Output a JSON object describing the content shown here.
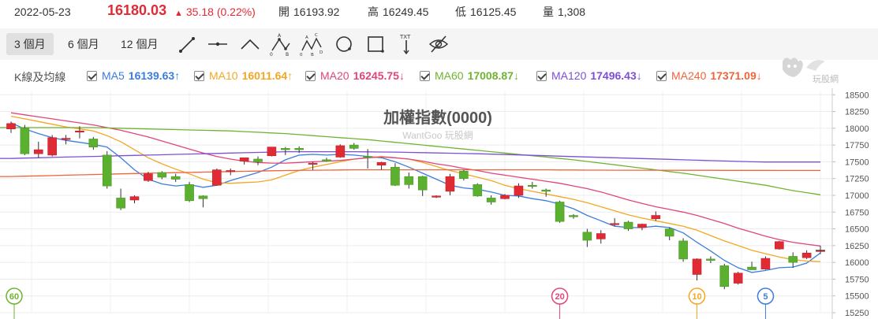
{
  "quote": {
    "date": "2022-05-23",
    "price": "16180.03",
    "change": "35.18 (0.22%)",
    "open_label": "開",
    "open": "16193.92",
    "high_label": "高",
    "high": "16249.45",
    "low_label": "低",
    "low": "16125.45",
    "volume_label": "量",
    "volume": "1,308",
    "up_color": "#e02b35"
  },
  "toolbar": {
    "ranges": [
      "3 個月",
      "6 個月",
      "12 個月"
    ],
    "active_range": "3 個月",
    "tools": [
      "line-tool-icon",
      "horizontal-line-tool-icon",
      "angle-tool-icon",
      "abc-pattern-tool-icon",
      "abcd-pattern-tool-icon",
      "circle-tool-icon",
      "rectangle-tool-icon",
      "text-tool-icon",
      "hide-drawings-icon"
    ],
    "text_tool_label": "TXT"
  },
  "ma_row": {
    "label": "K線及均線",
    "items": [
      {
        "name": "MA5",
        "value": "16139.63",
        "arrow": "↑",
        "color": "#3b7ddd"
      },
      {
        "name": "MA10",
        "value": "16011.64",
        "arrow": "↑",
        "color": "#f5a623"
      },
      {
        "name": "MA20",
        "value": "16245.75",
        "arrow": "↓",
        "color": "#e0457b"
      },
      {
        "name": "MA60",
        "value": "17008.87",
        "arrow": "↓",
        "color": "#6fb431"
      },
      {
        "name": "MA120",
        "value": "17496.43",
        "arrow": "↓",
        "color": "#7d4fd6"
      },
      {
        "name": "MA240",
        "value": "17371.09",
        "arrow": "↓",
        "color": "#f0643c"
      }
    ]
  },
  "logo_text": "玩股網",
  "chart_data": {
    "type": "candlestick",
    "title": "加權指數(0000)",
    "watermark": "WantGoo 玩股網",
    "ylim": [
      15250,
      18550
    ],
    "y_ticks": [
      18500,
      18250,
      18000,
      17750,
      17500,
      17250,
      17000,
      16750,
      16500,
      16250,
      16000,
      15750,
      15500,
      15250
    ],
    "grid": true,
    "up_color": "#e02b35",
    "down_color": "#5cb030",
    "candles": [
      {
        "o": 17990,
        "h": 18100,
        "l": 17930,
        "c": 18070
      },
      {
        "o": 18000,
        "h": 18050,
        "l": 17600,
        "c": 17620
      },
      {
        "o": 17620,
        "h": 17800,
        "l": 17560,
        "c": 17680
      },
      {
        "o": 17600,
        "h": 17900,
        "l": 17580,
        "c": 17860
      },
      {
        "o": 17850,
        "h": 17900,
        "l": 17760,
        "c": 17850
      },
      {
        "o": 17960,
        "h": 18030,
        "l": 17850,
        "c": 17960
      },
      {
        "o": 17840,
        "h": 17870,
        "l": 17680,
        "c": 17720
      },
      {
        "o": 17600,
        "h": 17660,
        "l": 17100,
        "c": 17140
      },
      {
        "o": 16960,
        "h": 17100,
        "l": 16780,
        "c": 16810
      },
      {
        "o": 16930,
        "h": 17000,
        "l": 16880,
        "c": 16980
      },
      {
        "o": 17220,
        "h": 17350,
        "l": 17200,
        "c": 17320
      },
      {
        "o": 17340,
        "h": 17360,
        "l": 17240,
        "c": 17270
      },
      {
        "o": 17280,
        "h": 17320,
        "l": 17200,
        "c": 17240
      },
      {
        "o": 17160,
        "h": 17200,
        "l": 16900,
        "c": 16920
      },
      {
        "o": 16990,
        "h": 17000,
        "l": 16820,
        "c": 16950
      },
      {
        "o": 17150,
        "h": 17400,
        "l": 17140,
        "c": 17380
      },
      {
        "o": 17360,
        "h": 17400,
        "l": 17300,
        "c": 17370
      },
      {
        "o": 17510,
        "h": 17560,
        "l": 17460,
        "c": 17560
      },
      {
        "o": 17540,
        "h": 17580,
        "l": 17450,
        "c": 17500
      },
      {
        "o": 17590,
        "h": 17720,
        "l": 17580,
        "c": 17720
      },
      {
        "o": 17700,
        "h": 17720,
        "l": 17600,
        "c": 17680
      },
      {
        "o": 17700,
        "h": 17730,
        "l": 17630,
        "c": 17680
      },
      {
        "o": 17470,
        "h": 17500,
        "l": 17380,
        "c": 17480
      },
      {
        "o": 17530,
        "h": 17560,
        "l": 17500,
        "c": 17510
      },
      {
        "o": 17570,
        "h": 17760,
        "l": 17560,
        "c": 17740
      },
      {
        "o": 17750,
        "h": 17780,
        "l": 17680,
        "c": 17700
      },
      {
        "o": 17580,
        "h": 17690,
        "l": 17400,
        "c": 17570
      },
      {
        "o": 17450,
        "h": 17500,
        "l": 17380,
        "c": 17490
      },
      {
        "o": 17420,
        "h": 17480,
        "l": 17140,
        "c": 17150
      },
      {
        "o": 17280,
        "h": 17340,
        "l": 17100,
        "c": 17160
      },
      {
        "o": 17280,
        "h": 17290,
        "l": 16990,
        "c": 17080
      },
      {
        "o": 16990,
        "h": 17000,
        "l": 16960,
        "c": 16990
      },
      {
        "o": 17060,
        "h": 17320,
        "l": 17000,
        "c": 17280
      },
      {
        "o": 17360,
        "h": 17380,
        "l": 17220,
        "c": 17250
      },
      {
        "o": 17160,
        "h": 17180,
        "l": 16980,
        "c": 16990
      },
      {
        "o": 16960,
        "h": 17000,
        "l": 16860,
        "c": 16900
      },
      {
        "o": 16950,
        "h": 17020,
        "l": 16940,
        "c": 17000
      },
      {
        "o": 17000,
        "h": 17180,
        "l": 16960,
        "c": 17140
      },
      {
        "o": 17150,
        "h": 17200,
        "l": 17100,
        "c": 17140
      },
      {
        "o": 17080,
        "h": 17100,
        "l": 16980,
        "c": 17060
      },
      {
        "o": 16900,
        "h": 16920,
        "l": 16590,
        "c": 16610
      },
      {
        "o": 16700,
        "h": 16720,
        "l": 16650,
        "c": 16680
      },
      {
        "o": 16450,
        "h": 16500,
        "l": 16230,
        "c": 16330
      },
      {
        "o": 16350,
        "h": 16480,
        "l": 16280,
        "c": 16430
      },
      {
        "o": 16580,
        "h": 16660,
        "l": 16540,
        "c": 16580
      },
      {
        "o": 16600,
        "h": 16620,
        "l": 16470,
        "c": 16500
      },
      {
        "o": 16520,
        "h": 16580,
        "l": 16480,
        "c": 16570
      },
      {
        "o": 16650,
        "h": 16760,
        "l": 16620,
        "c": 16700
      },
      {
        "o": 16500,
        "h": 16520,
        "l": 16330,
        "c": 16390
      },
      {
        "o": 16320,
        "h": 16360,
        "l": 16010,
        "c": 16050
      },
      {
        "o": 15820,
        "h": 16060,
        "l": 15730,
        "c": 16050
      },
      {
        "o": 16050,
        "h": 16090,
        "l": 15990,
        "c": 16030
      },
      {
        "o": 15950,
        "h": 15980,
        "l": 15600,
        "c": 15640
      },
      {
        "o": 15690,
        "h": 15860,
        "l": 15670,
        "c": 15840
      },
      {
        "o": 15930,
        "h": 16010,
        "l": 15890,
        "c": 15890
      },
      {
        "o": 15900,
        "h": 16090,
        "l": 15890,
        "c": 16060
      },
      {
        "o": 16200,
        "h": 16320,
        "l": 16190,
        "c": 16310
      },
      {
        "o": 16090,
        "h": 16150,
        "l": 15920,
        "c": 16000
      },
      {
        "o": 16070,
        "h": 16180,
        "l": 16050,
        "c": 16140
      },
      {
        "o": 16180,
        "h": 16250,
        "l": 16125,
        "c": 16180
      }
    ],
    "series": [
      {
        "name": "MA5",
        "color": "#3b7ddd",
        "values": [
          18080,
          17990,
          17920,
          17860,
          17820,
          17790,
          17760,
          17720,
          17560,
          17380,
          17240,
          17170,
          17140,
          17160,
          17120,
          17150,
          17220,
          17280,
          17340,
          17420,
          17530,
          17600,
          17610,
          17600,
          17610,
          17600,
          17580,
          17560,
          17500,
          17420,
          17330,
          17240,
          17150,
          17110,
          17090,
          17050,
          17000,
          16990,
          16950,
          16920,
          16870,
          16800,
          16700,
          16620,
          16540,
          16520,
          16520,
          16540,
          16520,
          16440,
          16300,
          16170,
          16030,
          15920,
          15850,
          15880,
          15920,
          15930,
          15990,
          16140
        ]
      },
      {
        "name": "MA10",
        "color": "#f5a623",
        "values": [
          18180,
          18140,
          18100,
          18060,
          18020,
          17990,
          17960,
          17890,
          17800,
          17680,
          17560,
          17470,
          17390,
          17320,
          17240,
          17190,
          17180,
          17190,
          17200,
          17230,
          17300,
          17370,
          17420,
          17460,
          17500,
          17540,
          17560,
          17580,
          17560,
          17540,
          17490,
          17430,
          17370,
          17320,
          17270,
          17220,
          17150,
          17100,
          17060,
          17020,
          16980,
          16940,
          16890,
          16830,
          16770,
          16710,
          16660,
          16620,
          16580,
          16540,
          16480,
          16400,
          16320,
          16250,
          16180,
          16130,
          16080,
          16040,
          16020,
          16011
        ]
      },
      {
        "name": "MA20",
        "color": "#e0457b",
        "values": [
          18230,
          18200,
          18170,
          18140,
          18110,
          18080,
          18050,
          18010,
          17970,
          17920,
          17870,
          17810,
          17750,
          17690,
          17630,
          17580,
          17540,
          17510,
          17490,
          17480,
          17480,
          17490,
          17500,
          17510,
          17520,
          17540,
          17560,
          17570,
          17560,
          17540,
          17510,
          17470,
          17440,
          17400,
          17370,
          17330,
          17300,
          17270,
          17240,
          17210,
          17180,
          17140,
          17100,
          17050,
          16990,
          16930,
          16880,
          16830,
          16790,
          16750,
          16700,
          16640,
          16580,
          16510,
          16450,
          16390,
          16340,
          16300,
          16270,
          16245
        ]
      },
      {
        "name": "MA60",
        "color": "#6fb431",
        "values": [
          18010,
          18010,
          18010,
          18010,
          18010,
          18010,
          18010,
          18005,
          18000,
          17995,
          17990,
          17985,
          17980,
          17975,
          17970,
          17965,
          17960,
          17950,
          17940,
          17930,
          17920,
          17905,
          17890,
          17875,
          17860,
          17845,
          17830,
          17810,
          17790,
          17770,
          17750,
          17730,
          17710,
          17690,
          17670,
          17650,
          17630,
          17610,
          17590,
          17570,
          17550,
          17530,
          17505,
          17480,
          17455,
          17430,
          17405,
          17380,
          17355,
          17330,
          17300,
          17270,
          17240,
          17210,
          17180,
          17150,
          17110,
          17070,
          17040,
          17008
        ]
      },
      {
        "name": "MA120",
        "color": "#7d4fd6",
        "values": [
          17550,
          17555,
          17560,
          17565,
          17570,
          17575,
          17580,
          17585,
          17590,
          17595,
          17600,
          17605,
          17610,
          17615,
          17620,
          17625,
          17630,
          17635,
          17640,
          17645,
          17650,
          17650,
          17650,
          17650,
          17650,
          17650,
          17648,
          17646,
          17644,
          17640,
          17636,
          17632,
          17628,
          17624,
          17620,
          17614,
          17608,
          17602,
          17596,
          17590,
          17584,
          17578,
          17572,
          17566,
          17560,
          17554,
          17548,
          17542,
          17536,
          17530,
          17524,
          17518,
          17512,
          17506,
          17500,
          17496,
          17496,
          17496,
          17496,
          17496
        ]
      },
      {
        "name": "MA240",
        "color": "#f0643c",
        "values": [
          17280,
          17285,
          17290,
          17295,
          17300,
          17305,
          17310,
          17315,
          17320,
          17325,
          17330,
          17334,
          17338,
          17342,
          17346,
          17350,
          17354,
          17358,
          17362,
          17366,
          17370,
          17372,
          17374,
          17376,
          17378,
          17380,
          17380,
          17380,
          17380,
          17380,
          17380,
          17380,
          17380,
          17380,
          17380,
          17380,
          17380,
          17380,
          17380,
          17380,
          17378,
          17378,
          17376,
          17376,
          17374,
          17374,
          17374,
          17374,
          17374,
          17373,
          17373,
          17373,
          17372,
          17372,
          17372,
          17372,
          17371,
          17371,
          17371,
          17371
        ]
      }
    ],
    "period_markers": [
      {
        "label": "60",
        "index": 0,
        "color": "#6fb431"
      },
      {
        "label": "20",
        "index": 40,
        "color": "#e0457b"
      },
      {
        "label": "10",
        "index": 50,
        "color": "#f5a623"
      },
      {
        "label": "5",
        "index": 55,
        "color": "#3b7ddd"
      }
    ]
  }
}
